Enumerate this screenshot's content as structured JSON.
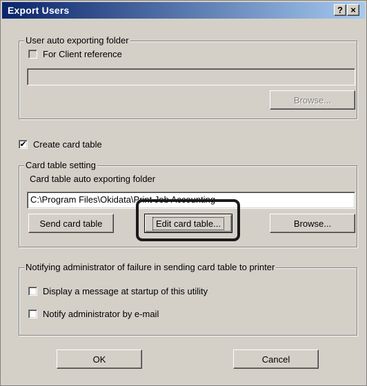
{
  "window": {
    "title": "Export Users",
    "help_button": "?",
    "close_button": "×"
  },
  "user_auto_export": {
    "legend": "User auto exporting folder",
    "for_client_reference_label": "For Client reference",
    "for_client_reference_checked": false,
    "folder_path": "",
    "browse_label": "Browse..."
  },
  "create_card_table": {
    "label": "Create card table",
    "checked": true
  },
  "card_table_setting": {
    "legend": "Card table setting",
    "folder_label": "Card table auto exporting folder",
    "folder_path": "C:\\Program Files\\Okidata\\Print Job Accounting",
    "send_button": "Send card table",
    "edit_button": "Edit card table...",
    "browse_button": "Browse..."
  },
  "notify": {
    "legend": "Notifying administrator of failure in sending card table to printer",
    "display_message_label": "Display a message at startup of this utility",
    "display_message_checked": false,
    "email_label": "Notify administrator by e-mail",
    "email_checked": false
  },
  "footer": {
    "ok_label": "OK",
    "cancel_label": "Cancel"
  },
  "icons": {
    "checkmark": "✔"
  }
}
